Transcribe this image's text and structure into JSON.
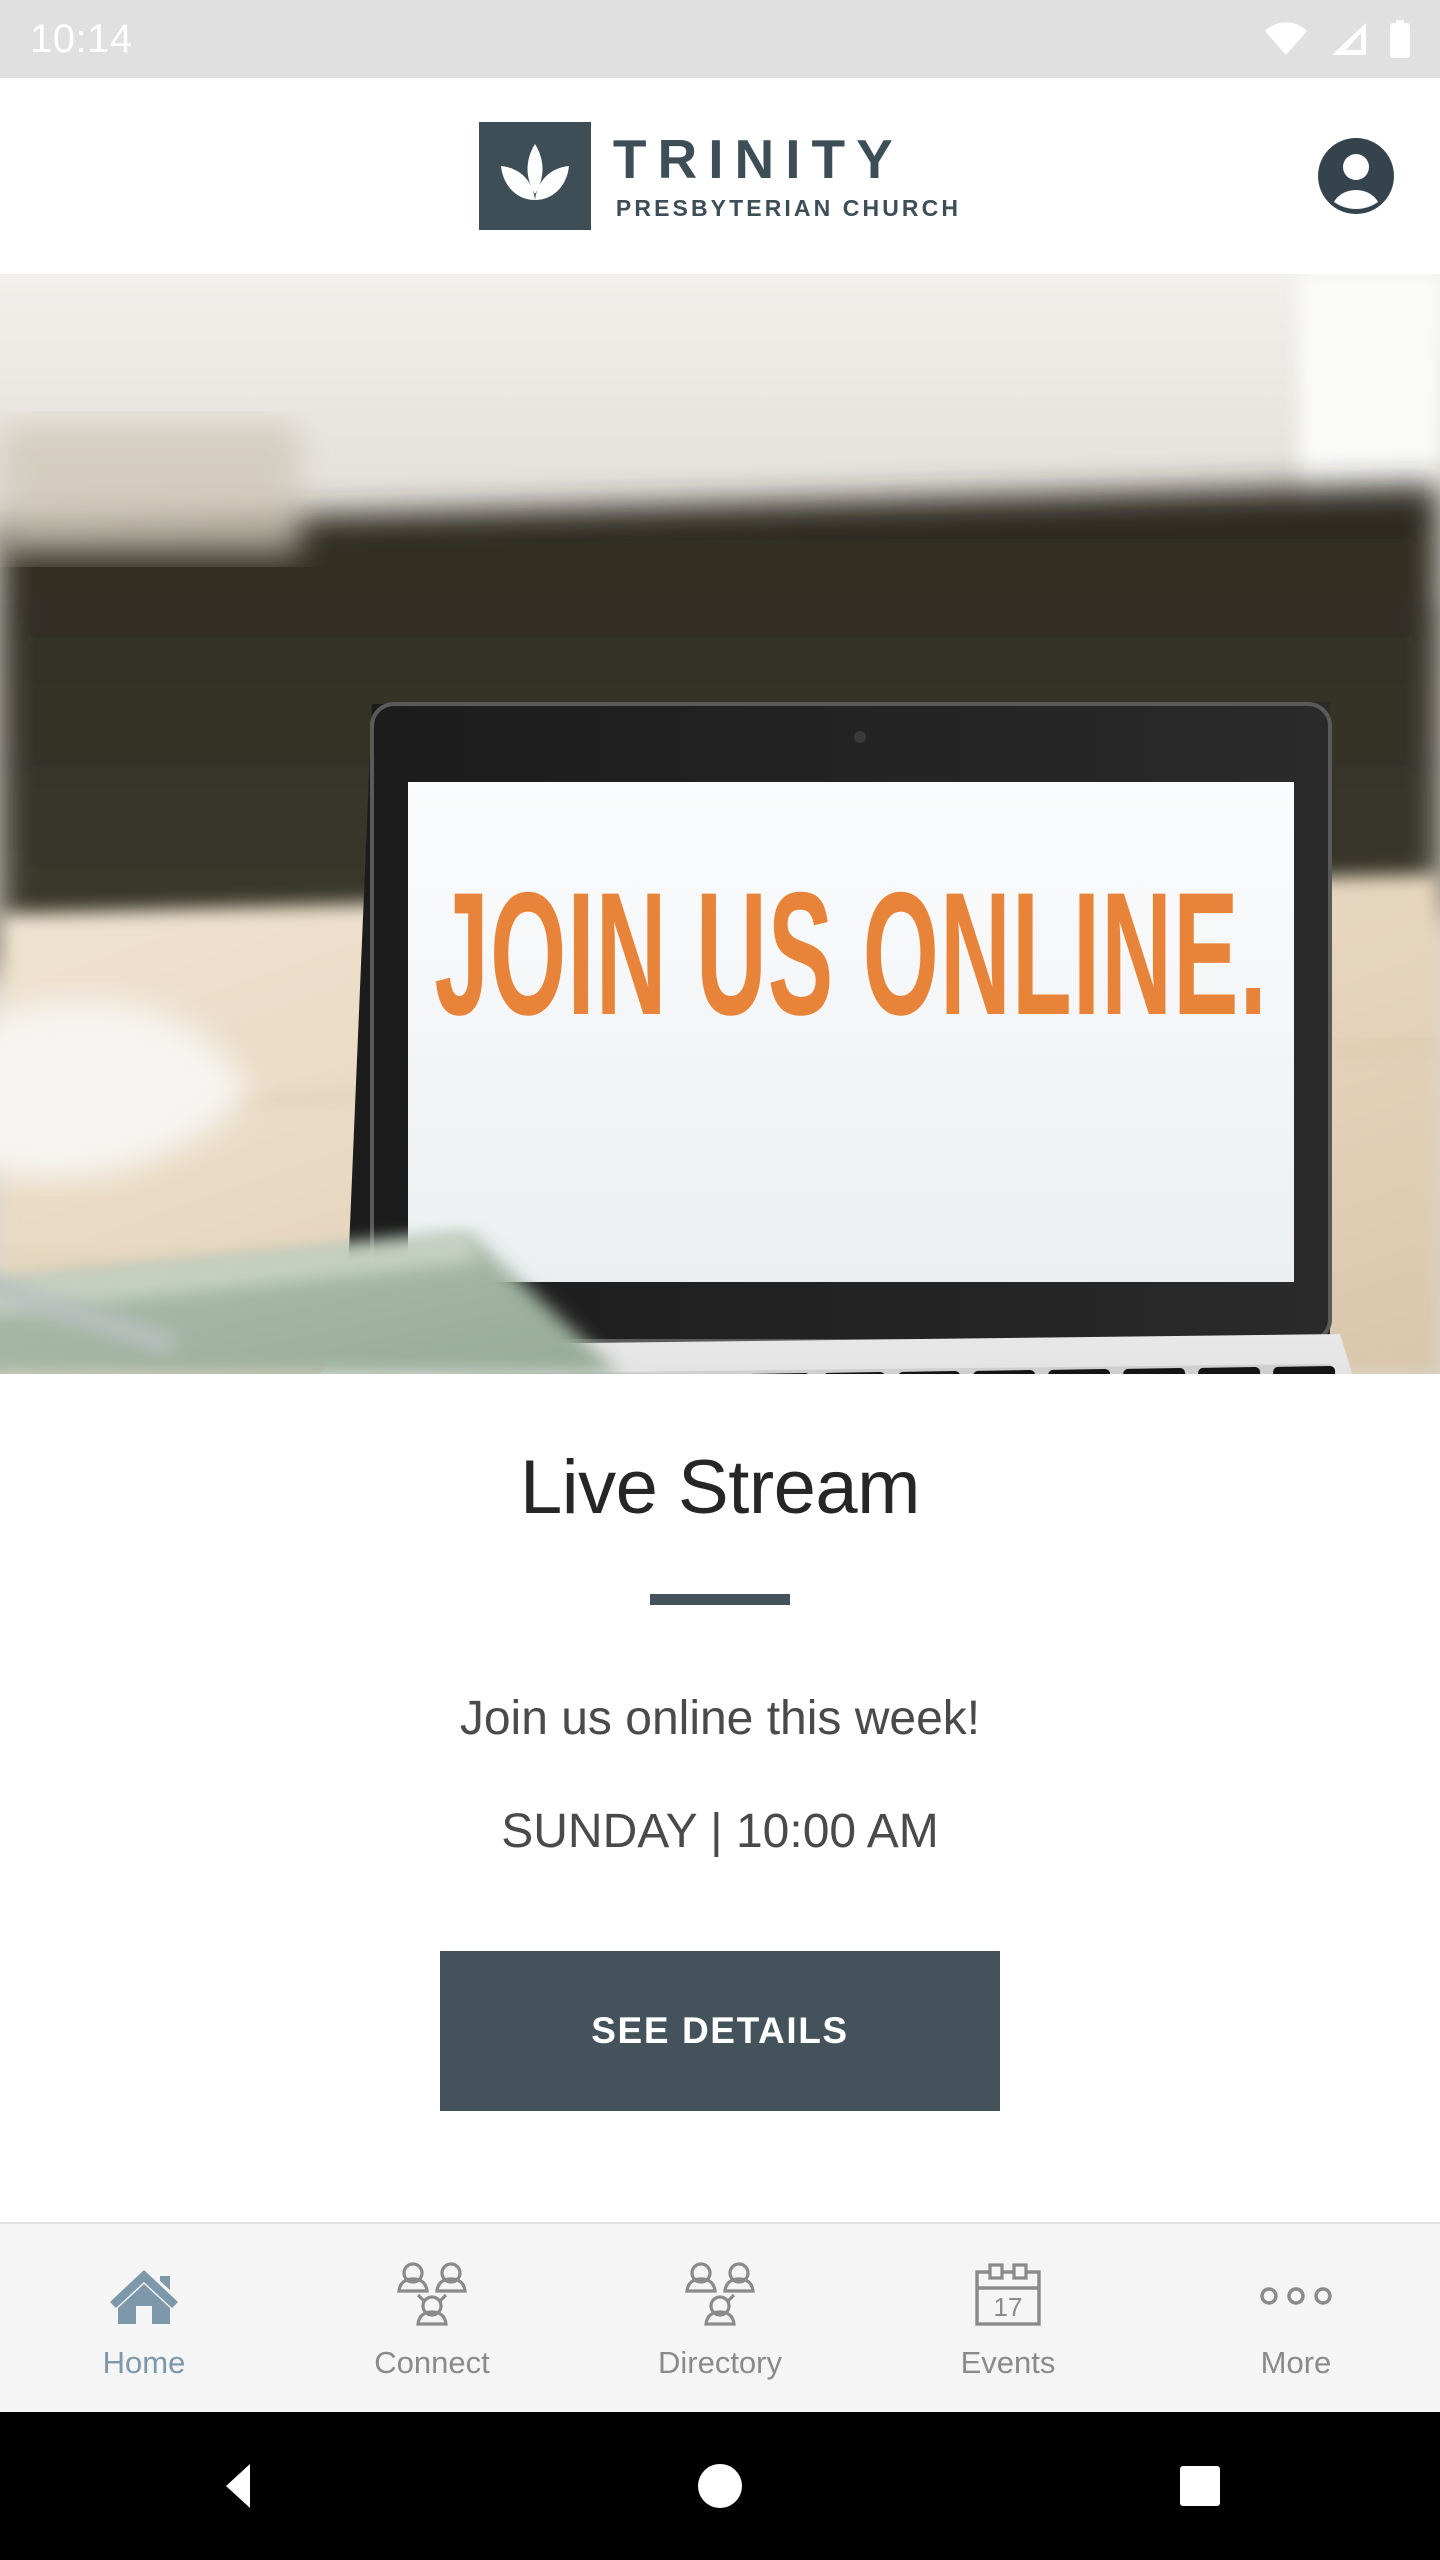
{
  "status_bar": {
    "time": "10:14",
    "icons": [
      "wifi-icon",
      "cellular-signal-icon",
      "battery-icon"
    ]
  },
  "header": {
    "logo_icon": "trinity-leaf-logo-icon",
    "brand_title": "TRINITY",
    "brand_subtitle": "PRESBYTERIAN CHURCH",
    "account_icon": "account-avatar-icon",
    "brand_color": "#3e4e57"
  },
  "hero": {
    "alt": "laptop-on-table-join-us-online",
    "screen_text": "JOIN US ONLINE.",
    "screen_text_color": "#e8833a"
  },
  "card": {
    "title": "Live Stream",
    "line1": "Join us online this week!",
    "line2": "SUNDAY | 10:00 AM",
    "button_label": "SEE DETAILS",
    "button_color": "#44535b",
    "divider_color": "#44535b"
  },
  "tab_bar": {
    "active_color": "#7d98aa",
    "inactive_color": "#8a8a8a",
    "items": [
      {
        "label": "Home",
        "icon": "home-icon",
        "active": true
      },
      {
        "label": "Connect",
        "icon": "people-network-icon",
        "active": false
      },
      {
        "label": "Directory",
        "icon": "people-group-icon",
        "active": false
      },
      {
        "label": "Events",
        "icon": "calendar-icon",
        "active": false,
        "calendar_day": "17"
      },
      {
        "label": "More",
        "icon": "three-dots-icon",
        "active": false
      }
    ]
  },
  "nav_bar": {
    "back_icon": "back-triangle-icon",
    "home_icon": "home-circle-icon",
    "recents_icon": "recents-square-icon"
  }
}
